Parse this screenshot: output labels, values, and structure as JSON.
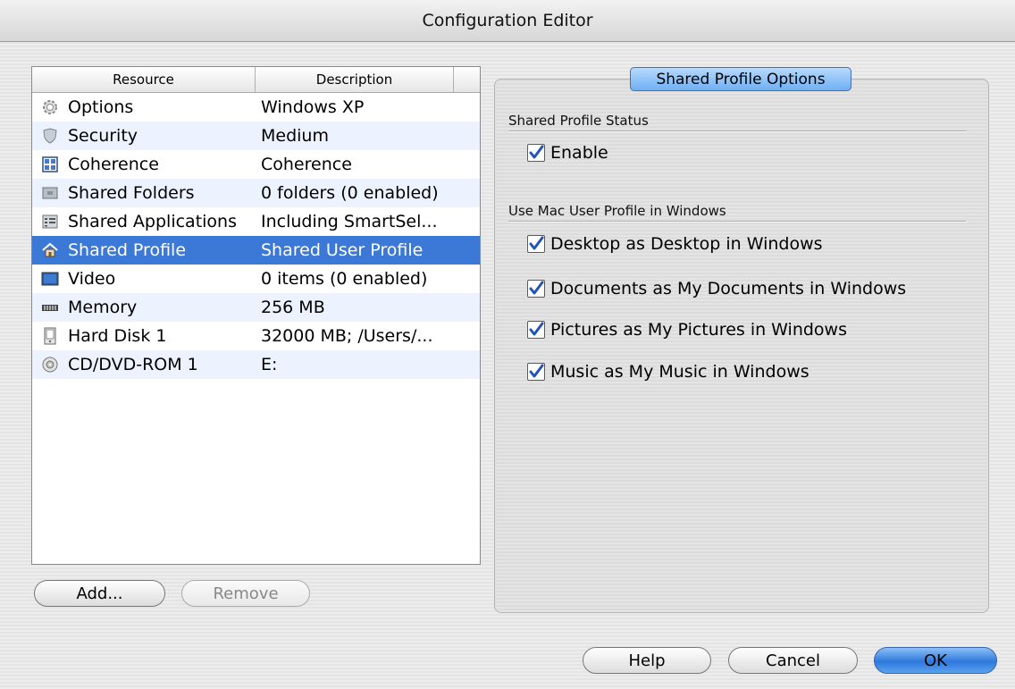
{
  "window": {
    "title": "Configuration Editor"
  },
  "table": {
    "headers": [
      "Resource",
      "Description"
    ],
    "rows": [
      {
        "resource": "Options",
        "description": "Windows XP",
        "icon": "gear-icon"
      },
      {
        "resource": "Security",
        "description": "Medium",
        "icon": "shield-icon"
      },
      {
        "resource": "Coherence",
        "description": "Coherence",
        "icon": "coherence-icon"
      },
      {
        "resource": "Shared Folders",
        "description": "0 folders (0 enabled)",
        "icon": "folder-icon"
      },
      {
        "resource": "Shared Applications",
        "description": "Including SmartSel...",
        "icon": "applications-icon"
      },
      {
        "resource": "Shared Profile",
        "description": "Shared User Profile",
        "icon": "home-icon",
        "selected": true
      },
      {
        "resource": "Video",
        "description": "0 items (0 enabled)",
        "icon": "monitor-icon"
      },
      {
        "resource": "Memory",
        "description": "256 MB",
        "icon": "memory-icon"
      },
      {
        "resource": "Hard Disk 1",
        "description": "32000 MB; /Users/...",
        "icon": "hard-disk-icon"
      },
      {
        "resource": "CD/DVD-ROM 1",
        "description": "E:",
        "icon": "cd-icon"
      }
    ],
    "selected_color": "#3c79d6"
  },
  "buttons": {
    "add": "Add...",
    "remove": "Remove",
    "help": "Help",
    "cancel": "Cancel",
    "ok": "OK"
  },
  "panel": {
    "title": "Shared Profile Options",
    "status_section": "Shared Profile Status",
    "enable_label": "Enable",
    "profile_section": "Use Mac User Profile in Windows",
    "options": [
      "Desktop as Desktop in Windows",
      "Documents as My Documents in Windows",
      "Pictures as My Pictures in Windows",
      "Music as My Music in Windows"
    ]
  }
}
